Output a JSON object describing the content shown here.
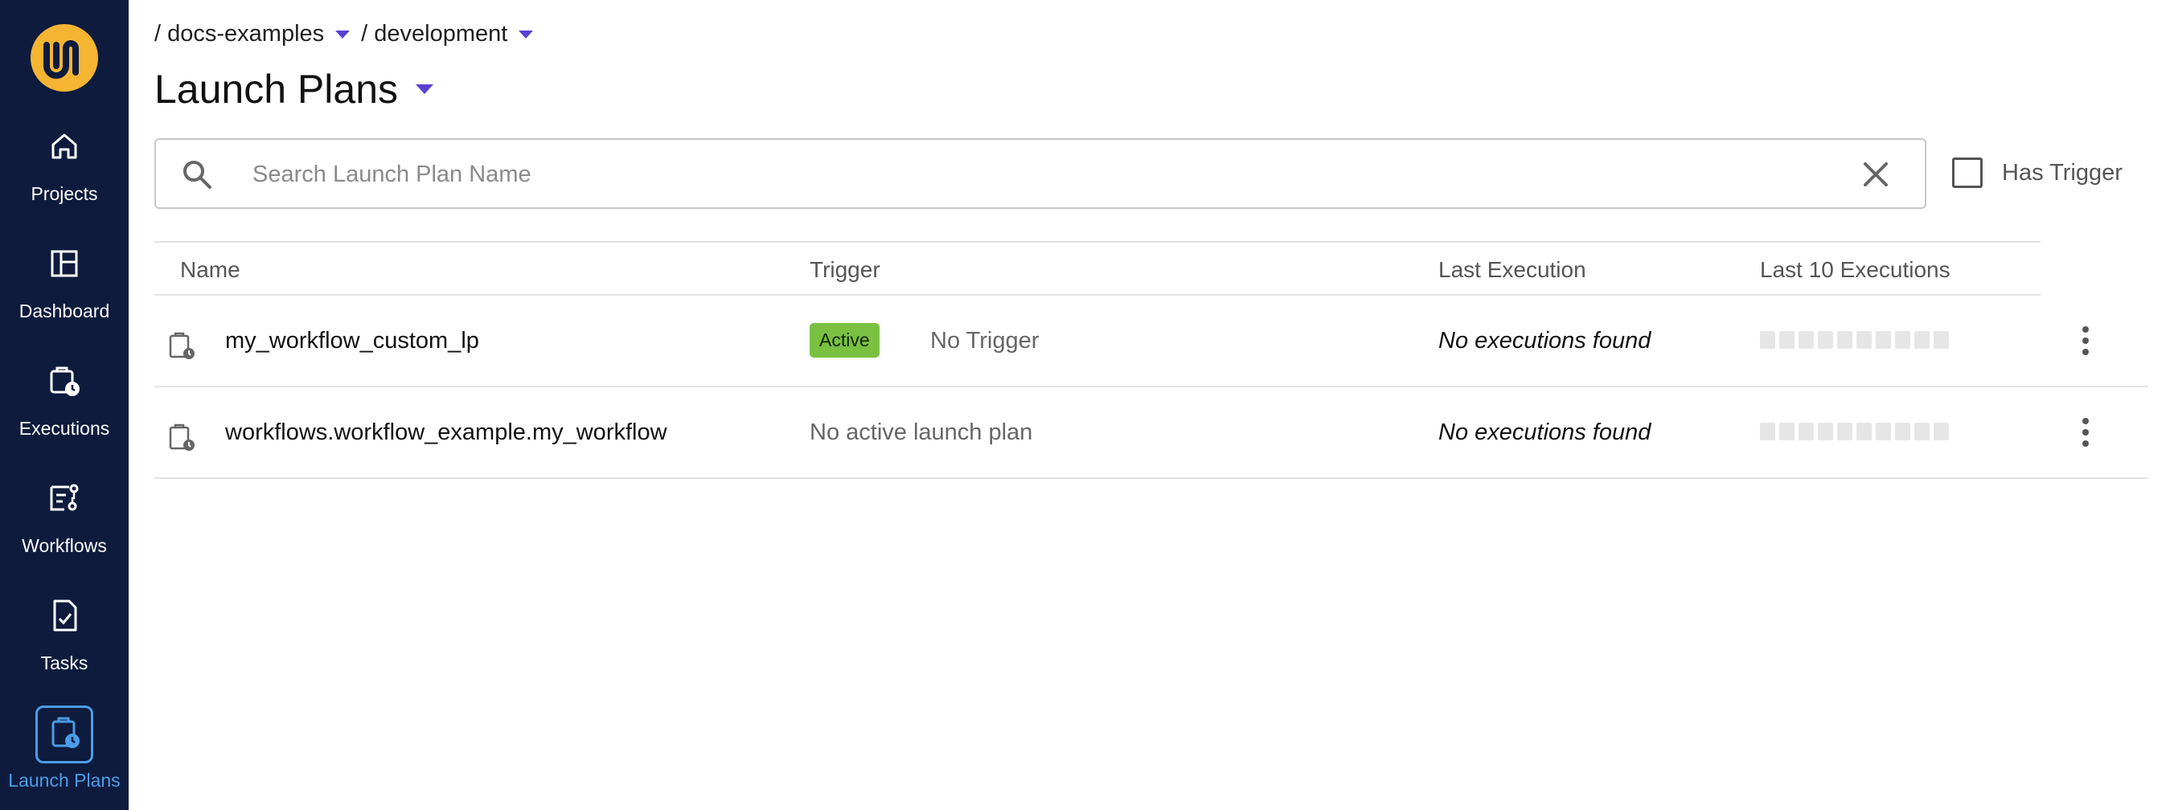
{
  "sidebar": {
    "items": [
      {
        "label": "Projects",
        "icon": "home-icon"
      },
      {
        "label": "Dashboard",
        "icon": "dashboard-icon"
      },
      {
        "label": "Executions",
        "icon": "executions-icon"
      },
      {
        "label": "Workflows",
        "icon": "workflows-icon"
      },
      {
        "label": "Tasks",
        "icon": "tasks-icon"
      },
      {
        "label": "Launch Plans",
        "icon": "launch-plans-icon"
      }
    ],
    "active": "Launch Plans"
  },
  "breadcrumb": {
    "project": "/ docs-examples",
    "domain": "/ development"
  },
  "page": {
    "title": "Launch Plans"
  },
  "search": {
    "placeholder": "Search Launch Plan Name",
    "value": ""
  },
  "filter": {
    "has_trigger_label": "Has Trigger",
    "checked": false
  },
  "table": {
    "columns": [
      "Name",
      "Trigger",
      "Last Execution",
      "Last 10 Executions"
    ],
    "rows": [
      {
        "name": "my_workflow_custom_lp",
        "status_badge": "Active",
        "trigger": "No Trigger",
        "last_execution": "No executions found"
      },
      {
        "name": "workflows.workflow_example.my_workflow",
        "status_badge": "",
        "trigger": "No active launch plan",
        "last_execution": "No executions found"
      }
    ]
  },
  "colors": {
    "sidebar_bg": "#0e1b3d",
    "accent": "#5a3fd3",
    "active_nav": "#4a9de8",
    "badge_active": "#7ac142",
    "logo": "#f5b533"
  }
}
